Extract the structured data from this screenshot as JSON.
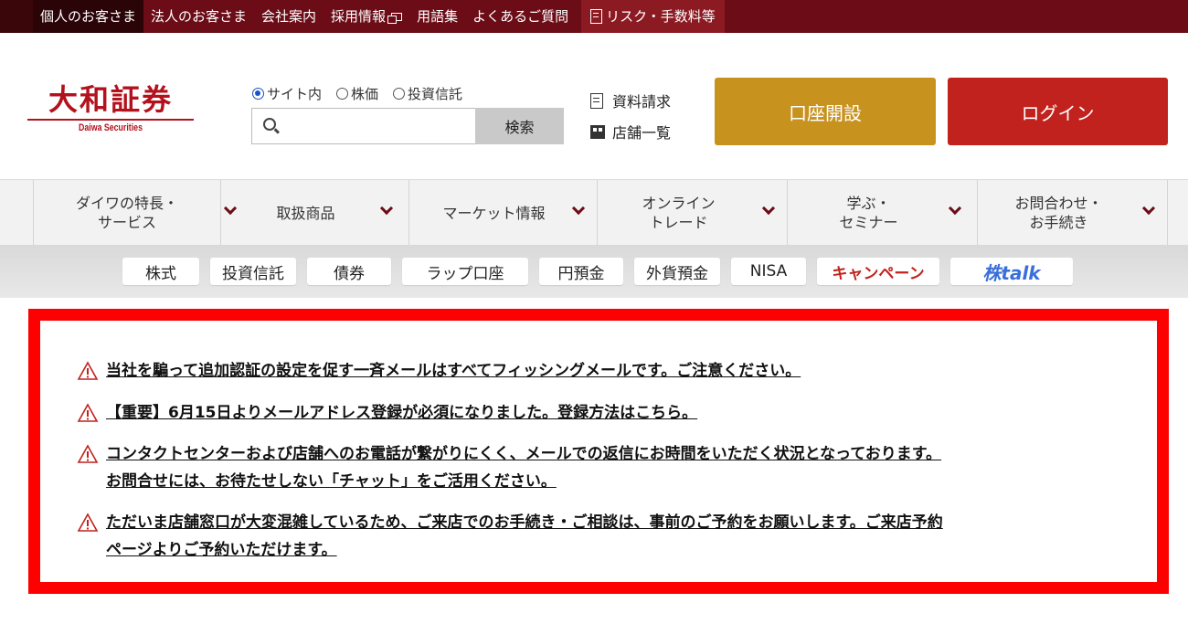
{
  "topbar": {
    "items": [
      "個人のお客さま",
      "法人のお客さま",
      "会社案内",
      "採用情報",
      "用語集",
      "よくあるご質問"
    ],
    "risk_label": "リスク・手数料等"
  },
  "logo": {
    "jp": "大和証券",
    "en": "Daiwa Securities"
  },
  "search": {
    "radios": [
      "サイト内",
      "株価",
      "投資信託"
    ],
    "selected": "サイト内",
    "placeholder": "",
    "button": "検索"
  },
  "util": {
    "docs": "資料請求",
    "stores": "店舗一覧"
  },
  "buttons": {
    "open_account": "口座開設",
    "login": "ログイン"
  },
  "gnav": [
    {
      "line1": "ダイワの特長・",
      "line2": "サービス"
    },
    {
      "line1": "取扱商品",
      "line2": ""
    },
    {
      "line1": "マーケット情報",
      "line2": ""
    },
    {
      "line1": "オンライン",
      "line2": "トレード"
    },
    {
      "line1": "学ぶ・",
      "line2": "セミナー"
    },
    {
      "line1": "お問合わせ・",
      "line2": "お手続き"
    }
  ],
  "subnav": [
    "株式",
    "投資信託",
    "債券",
    "ラップ口座",
    "円預金",
    "外貨預金",
    "NISA",
    "キャンペーン",
    "株talk"
  ],
  "notices": [
    {
      "lines": [
        "当社を騙って追加認証の設定を促す一斉メールはすべてフィッシングメールです。ご注意ください。"
      ]
    },
    {
      "lines": [
        "【重要】6月15日よりメールアドレス登録が必須になりました。登録方法はこちら。"
      ]
    },
    {
      "lines": [
        "コンタクトセンターおよび店舗へのお電話が繋がりにくく、メールでの返信にお時間をいただく状況となっております。",
        "お問合せには、お待たせしない「チャット」をご活用ください。"
      ]
    },
    {
      "lines": [
        "ただいま店舗窓口が大変混雑しているため、ご来店でのお手続き・ご相談は、事前のご予約をお願いします。ご来店予約",
        "ページよりご予約いただけます。"
      ]
    }
  ],
  "colors": {
    "topbar": "#6b0c17",
    "open_account": "#c8921f",
    "login": "#c2221d",
    "notice_border": "#ff0000"
  }
}
